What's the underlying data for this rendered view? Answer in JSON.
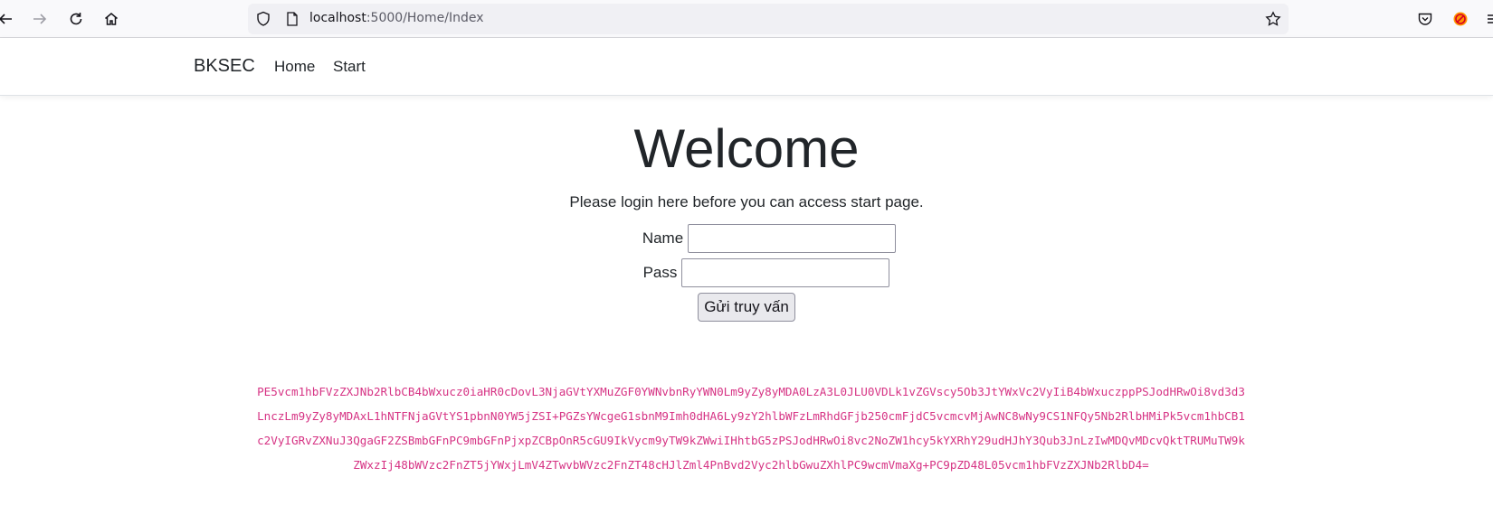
{
  "browser": {
    "url_host": "localhost",
    "url_path": ":5000/Home/Index"
  },
  "navbar": {
    "brand": "BKSEC",
    "links": [
      "Home",
      "Start"
    ]
  },
  "main": {
    "title": "Welcome",
    "lead": "Please login here before you can access start page.",
    "name_label": "Name",
    "pass_label": "Pass",
    "name_value": "",
    "pass_value": "",
    "submit_label": "Gửi truy vấn"
  },
  "encoded_lines": [
    "PE5vcm1hbFVzZXJNb2RlbCB4bWxucz0iaHR0cDovL3NjaGVtYXMuZGF0YWNvbnRyYWN0Lm9yZy8yMDA0LzA3L0JLU0VDLk1vZGVscy5Ob3JtYWxVc2VyIiB4bWxuczppPSJodHRwOi8vd3d3",
    "LnczLm9yZy8yMDAxL1hNTFNjaGVtYS1pbnN0YW5jZSI+PGZsYWcgeG1sbnM9Imh0dHA6Ly9zY2hlbWFzLmRhdGFjb250cmFjdC5vcmcvMjAwNC8wNy9CS1NFQy5Nb2RlbHMiPk5vcm1hbCB1",
    "c2VyIGRvZXNuJ3QgaGF2ZSBmbGFnPC9mbGFnPjxpZCBpOnR5cGU9IkVycm9yTW9kZWwiIHhtbG5zPSJodHRwOi8vc2NoZW1hcy5kYXRhY29udHJhY3Qub3JnLzIwMDQvMDcvQktTRUMuTW9k",
    "ZWxzIj48bWVzc2FnZT5jYWxjLmV4ZTwvbWVzc2FnZT48cHJlZml4PnBvd2Vyc2hlbGwuZXhlPC9wcmVmaXg+PC9pZD48L05vcm1hbFVzZXJNb2RlbD4="
  ]
}
